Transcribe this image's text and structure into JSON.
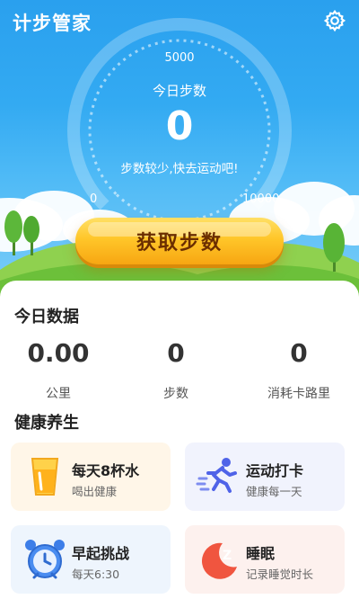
{
  "header": {
    "app_title": "计步管家",
    "settings_icon": "gear-icon"
  },
  "gauge": {
    "top_value": "5000",
    "today_label": "今日步数",
    "steps": "0",
    "hint": "步数较少,快去运动吧!",
    "min_label": "0",
    "max_label": "10000",
    "progress": 0
  },
  "get_steps_button": "获取步数",
  "today_data": {
    "title": "今日数据",
    "stats": [
      {
        "value": "0.00",
        "label": "公里"
      },
      {
        "value": "0",
        "label": "步数"
      },
      {
        "value": "0",
        "label": "消耗卡路里"
      }
    ]
  },
  "health": {
    "title": "健康养生",
    "tiles": [
      {
        "title": "每天8杯水",
        "subtitle": "喝出健康",
        "icon": "water-cup-icon",
        "bg": "#fff6e8"
      },
      {
        "title": "运动打卡",
        "subtitle": "健康每一天",
        "icon": "running-icon",
        "bg": "#f1f3fd"
      },
      {
        "title": "早起挑战",
        "subtitle": "每天6:30",
        "icon": "alarm-clock-icon",
        "bg": "#eef5fd"
      },
      {
        "title": "睡眠",
        "subtitle": "记录睡觉时长",
        "icon": "sleep-moon-icon",
        "bg": "#fdf1ee"
      }
    ]
  },
  "colors": {
    "sky_top": "#2aa0ee",
    "button": "#ffc629",
    "button_text": "#6b2e00"
  }
}
